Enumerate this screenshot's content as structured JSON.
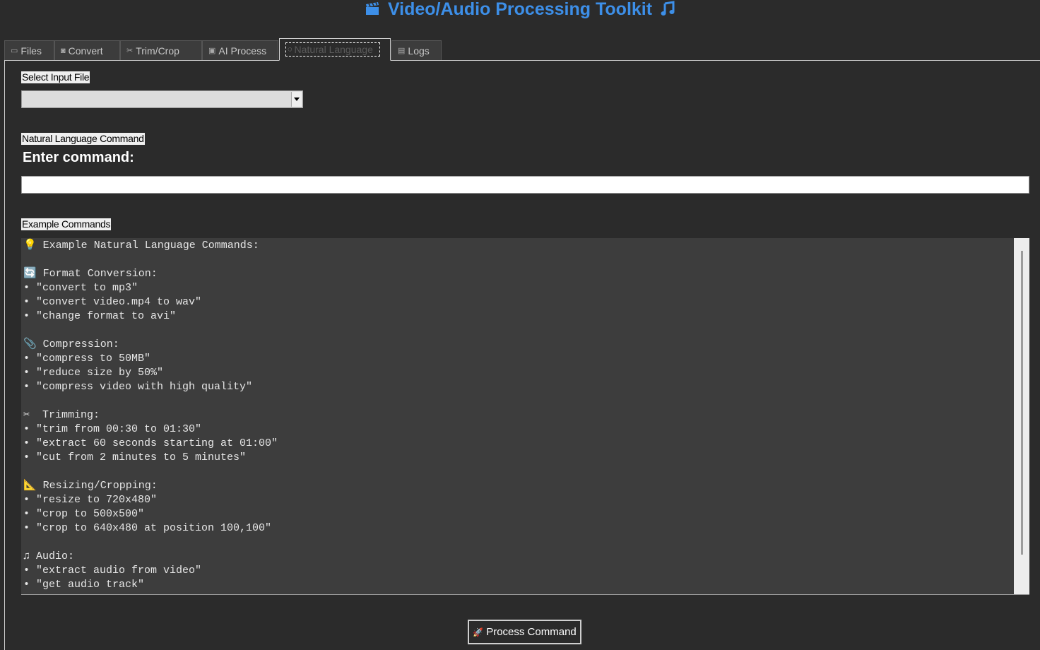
{
  "app": {
    "title": "Video/Audio Processing Toolkit",
    "title_icon_left": "clapperboard-icon",
    "title_icon_right": "music-note-icon",
    "accent_color": "#3d8fe8"
  },
  "tabs": [
    {
      "label": "Files",
      "icon": "folder-icon"
    },
    {
      "label": "Convert",
      "icon": "convert-icon"
    },
    {
      "label": "Trim/Crop",
      "icon": "scissors-icon"
    },
    {
      "label": "AI Process",
      "icon": "robot-icon"
    },
    {
      "label": "Natural Language",
      "icon": "chat-icon",
      "active": true
    },
    {
      "label": "Logs",
      "icon": "log-icon"
    }
  ],
  "input_section": {
    "label": "Select Input File",
    "selected_value": ""
  },
  "command_section": {
    "label": "Natural Language Command",
    "prompt": "Enter command:",
    "value": ""
  },
  "examples_section": {
    "label": "Example Commands",
    "lines": [
      "💡 Example Natural Language Commands:",
      "",
      "🔄 Format Conversion:",
      "• \"convert to mp3\"",
      "• \"convert video.mp4 to wav\"",
      "• \"change format to avi\"",
      "",
      "📎 Compression:",
      "• \"compress to 50MB\"",
      "• \"reduce size by 50%\"",
      "• \"compress video with high quality\"",
      "",
      "✂  Trimming:",
      "• \"trim from 00:30 to 01:30\"",
      "• \"extract 60 seconds starting at 01:00\"",
      "• \"cut from 2 minutes to 5 minutes\"",
      "",
      "📐 Resizing/Cropping:",
      "• \"resize to 720x480\"",
      "• \"crop to 500x500\"",
      "• \"crop to 640x480 at position 100,100\"",
      "",
      "♫ Audio:",
      "• \"extract audio from video\"",
      "• \"get audio track\""
    ]
  },
  "actions": {
    "process_label": "Process Command",
    "process_icon": "rocket-icon"
  }
}
